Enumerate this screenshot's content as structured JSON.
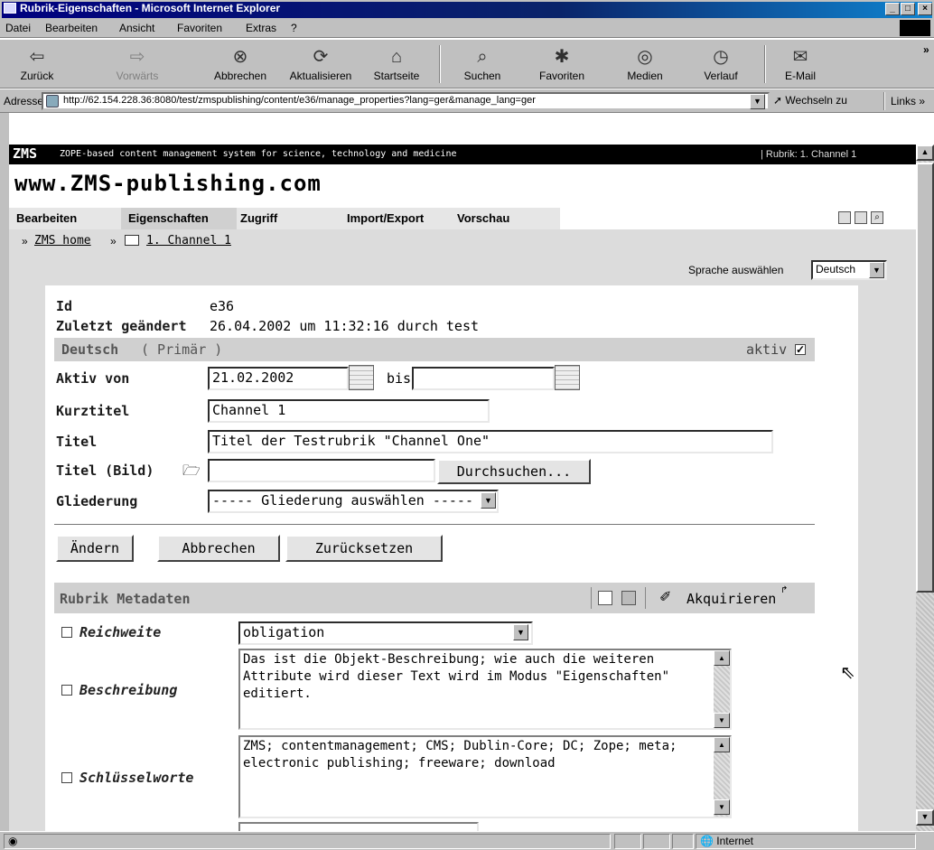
{
  "window": {
    "title": "Rubrik-Eigenschaften - Microsoft Internet Explorer",
    "min": "_",
    "max": "□",
    "close": "×"
  },
  "menu": [
    "Datei",
    "Bearbeiten",
    "Ansicht",
    "Favoriten",
    "Extras",
    "?"
  ],
  "toolbar": {
    "back": "Zurück",
    "forward": "Vorwärts",
    "stop": "Abbrechen",
    "refresh": "Aktualisieren",
    "home": "Startseite",
    "search": "Suchen",
    "favorites": "Favoriten",
    "media": "Medien",
    "history": "Verlauf",
    "mail": "E-Mail",
    "more": "»"
  },
  "address": {
    "label": "Adresse",
    "url": "http://62.154.228.36:8080/test/zmspublishing/content/e36/manage_properties?lang=ger&manage_lang=ger",
    "go": "Wechseln zu",
    "links": "Links »"
  },
  "zms": {
    "logo": "ZMS",
    "tagline": "ZOPE-based content management system for science, technology and medicine",
    "rubrik": "| Rubrik: 1. Channel 1",
    "site": "www.ZMS-publishing.com"
  },
  "tabs": [
    "Bearbeiten",
    "Eigenschaften",
    "Zugriff",
    "Import/Export",
    "Vorschau"
  ],
  "breadcrumb": {
    "home": "ZMS home",
    "sep": "»",
    "current": "1. Channel 1"
  },
  "language": {
    "label": "Sprache auswählen",
    "value": "Deutsch"
  },
  "info": {
    "id_label": "Id",
    "id_value": "e36",
    "changed_label": "Zuletzt geändert",
    "changed_value": "26.04.2002 um 11:32:16 durch test"
  },
  "lang_section": {
    "title": "Deutsch",
    "primary": "( Primär )",
    "active_label": "aktiv",
    "active": true
  },
  "form": {
    "aktiv_von_label": "Aktiv von",
    "aktiv_von": "21.02.2002",
    "bis_label": "bis",
    "bis": "",
    "kurztitel_label": "Kurztitel",
    "kurztitel": "Channel 1",
    "titel_label": "Titel",
    "titel": "Titel der Testrubrik \"Channel One\"",
    "titel_bild_label": "Titel (Bild)",
    "titel_bild": "",
    "browse": "Durchsuchen...",
    "gliederung_label": "Gliederung",
    "gliederung": "----- Gliederung auswählen -----"
  },
  "actions": {
    "save": "Ändern",
    "cancel": "Abbrechen",
    "reset": "Zurücksetzen"
  },
  "metadata": {
    "title": "Rubrik Metadaten",
    "acquire": "Akquirieren",
    "reichweite_label": "Reichweite",
    "reichweite": "obligation",
    "beschreibung_label": "Beschreibung",
    "beschreibung": "Das ist die Objekt-Beschreibung; wie auch die weiteren Attribute wird dieser Text wird im Modus \"Eigenschaften\" editiert.",
    "schluesselworte_label": "Schlüsselworte",
    "schluesselworte": "ZMS; contentmanagement; CMS; Dublin-Core; DC; Zope; meta; electronic publishing; freeware; download"
  },
  "status": {
    "zone": "Internet"
  }
}
